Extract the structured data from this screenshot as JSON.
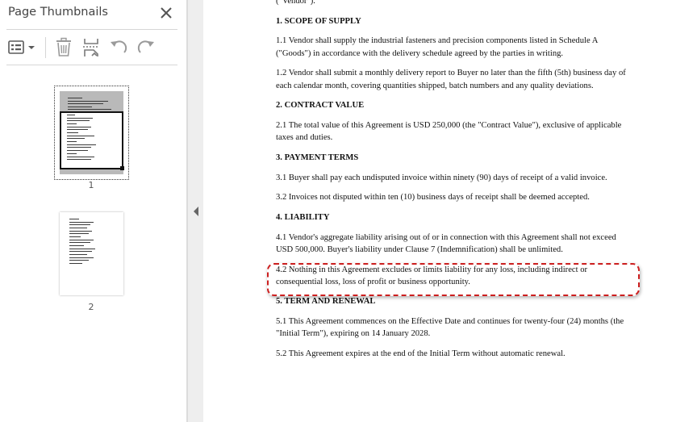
{
  "sidebar": {
    "title": "Page Thumbnails",
    "icons": {
      "close": "close-icon",
      "options": "thumbnail-options-icon",
      "delete": "trash-icon",
      "insert": "insert-page-icon",
      "rotate_ccw": "rotate-counterclockwise-icon",
      "rotate_cw": "rotate-clockwise-icon"
    },
    "thumbnails": [
      {
        "label": "1",
        "selected": true
      },
      {
        "label": "2",
        "selected": false
      }
    ]
  },
  "splitter": {
    "icon": "collapse-left-arrow-icon"
  },
  "colors": {
    "highlight_border": "#cc1f1f",
    "toolbar_icon": "#5a5a5a",
    "disabled_icon": "#9a9a9a",
    "sidebar_divider": "#d6d6d6"
  },
  "document": {
    "vendor_tail": "(\"Vendor\").",
    "sections": [
      {
        "heading": "1. SCOPE OF SUPPLY",
        "clauses": [
          "1.1 Vendor shall supply the industrial fasteners and precision components listed in Schedule A (\"Goods\") in accordance with the delivery schedule agreed by the parties in writing.",
          "1.2 Vendor shall submit a monthly delivery report to Buyer no later than the fifth (5th) business day of each calendar month, covering quantities shipped, batch numbers and any quality deviations."
        ]
      },
      {
        "heading": "2. CONTRACT VALUE",
        "clauses": [
          "2.1 The total value of this Agreement is USD 250,000 (the \"Contract Value\"), exclusive of applicable taxes and duties."
        ]
      },
      {
        "heading": "3. PAYMENT TERMS",
        "clauses": [
          "3.1 Buyer shall pay each undisputed invoice within ninety (90) days of receipt of a valid invoice.",
          "3.2 Invoices not disputed within ten (10) business days of receipt shall be deemed accepted."
        ]
      },
      {
        "heading": "4. LIABILITY",
        "clauses": [
          "4.1 Vendor's aggregate liability arising out of or in connection with this Agreement shall not exceed USD 500,000. Buyer's liability under Clause 7 (Indemnification) shall be unlimited.",
          "4.2 Nothing in this Agreement excludes or limits liability for any loss, including indirect or consequential loss, loss of profit or business opportunity."
        ]
      },
      {
        "heading": "5. TERM AND RENEWAL",
        "clauses": [
          "5.1 This Agreement commences on the Effective Date and continues for twenty-four (24) months (the \"Initial Term\"), expiring on 14 January 2028.",
          "5.2 This Agreement expires at the end of the Initial Term without automatic renewal."
        ]
      }
    ]
  }
}
